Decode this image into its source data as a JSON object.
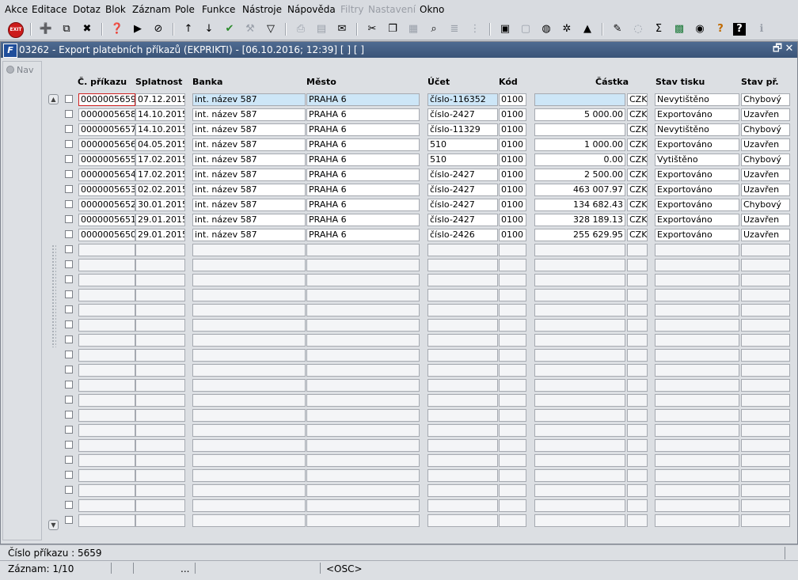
{
  "menu": [
    "Akce",
    "Editace",
    "Dotaz",
    "Blok",
    "Záznam",
    "Pole",
    "Funkce",
    "Nástroje",
    "Nápověda",
    "Filtry",
    "Nastavení",
    "Okno"
  ],
  "menu_disabled": [
    "Filtry",
    "Nastavení"
  ],
  "toolbar": {
    "exit_label": "EXIT",
    "icons": [
      "exit-icon",
      "insert-record-icon",
      "duplicate-record-icon",
      "delete-record-icon",
      "enter-query-icon",
      "execute-query-icon",
      "cancel-query-icon",
      "sort-ascending-icon",
      "sort-descending-icon",
      "commit-checkmark-icon",
      "wrench-icon",
      "filter-icon",
      "print-icon",
      "print-setup-icon",
      "send-mail-icon",
      "cut-icon",
      "copy-icon",
      "paste-icon",
      "search-icon",
      "list-icon",
      "tree-icon",
      "clipboard-icon",
      "form-icon",
      "globe-icon",
      "settings-icon",
      "bookmark-icon",
      "edit-chart-icon",
      "refresh-icon",
      "sum-icon",
      "excel-icon",
      "web-icon",
      "help-query-icon",
      "help-icon",
      "info-icon"
    ]
  },
  "window": {
    "title": "03262 - Export platebních příkazů (EKPRIKTI) - [06.10.2016; 12:39]  [ ]  [ ]",
    "nav_label": "Nav",
    "restore_label": "🗗",
    "close_label": "✕"
  },
  "table": {
    "headers": {
      "prikaz": "Č. příkazu",
      "splatnost": "Splatnost",
      "banka": "Banka",
      "mesto": "Město",
      "ucet": "Účet",
      "kod": "Kód",
      "castka": "Částka",
      "stav_tisku": "Stav tisku",
      "stav_pr": "Stav př."
    },
    "rows": [
      {
        "prikaz": "0000005659",
        "splatnost": "07.12.2015",
        "banka": "int. název 587",
        "mesto": "PRAHA 6",
        "ucet": "číslo-116352",
        "kod": "0100",
        "castka": "",
        "mena": "CZK",
        "stav_tisku": "Nevytištěno",
        "stav_pr": "Chybový"
      },
      {
        "prikaz": "0000005658",
        "splatnost": "14.10.2015",
        "banka": "int. název 587",
        "mesto": "PRAHA 6",
        "ucet": "číslo-2427",
        "kod": "0100",
        "castka": "5 000.00",
        "mena": "CZK",
        "stav_tisku": "Exportováno",
        "stav_pr": "Uzavřen"
      },
      {
        "prikaz": "0000005657",
        "splatnost": "14.10.2015",
        "banka": "int. název 587",
        "mesto": "PRAHA 6",
        "ucet": "číslo-11329",
        "kod": "0100",
        "castka": "",
        "mena": "CZK",
        "stav_tisku": "Nevytištěno",
        "stav_pr": "Chybový"
      },
      {
        "prikaz": "0000005656",
        "splatnost": "04.05.2015",
        "banka": "int. název 587",
        "mesto": "PRAHA 6",
        "ucet": "510",
        "kod": "0100",
        "castka": "1 000.00",
        "mena": "CZK",
        "stav_tisku": "Exportováno",
        "stav_pr": "Uzavřen"
      },
      {
        "prikaz": "0000005655",
        "splatnost": "17.02.2015",
        "banka": "int. název 587",
        "mesto": "PRAHA 6",
        "ucet": "510",
        "kod": "0100",
        "castka": "0.00",
        "mena": "CZK",
        "stav_tisku": "Vytištěno",
        "stav_pr": "Chybový"
      },
      {
        "prikaz": "0000005654",
        "splatnost": "17.02.2015",
        "banka": "int. název 587",
        "mesto": "PRAHA 6",
        "ucet": "číslo-2427",
        "kod": "0100",
        "castka": "2 500.00",
        "mena": "CZK",
        "stav_tisku": "Exportováno",
        "stav_pr": "Uzavřen"
      },
      {
        "prikaz": "0000005653",
        "splatnost": "02.02.2015",
        "banka": "int. název 587",
        "mesto": "PRAHA 6",
        "ucet": "číslo-2427",
        "kod": "0100",
        "castka": "463 007.97",
        "mena": "CZK",
        "stav_tisku": "Exportováno",
        "stav_pr": "Uzavřen"
      },
      {
        "prikaz": "0000005652",
        "splatnost": "30.01.2015",
        "banka": "int. název 587",
        "mesto": "PRAHA 6",
        "ucet": "číslo-2427",
        "kod": "0100",
        "castka": "134 682.43",
        "mena": "CZK",
        "stav_tisku": "Exportováno",
        "stav_pr": "Chybový"
      },
      {
        "prikaz": "0000005651",
        "splatnost": "29.01.2015",
        "banka": "int. název 587",
        "mesto": "PRAHA 6",
        "ucet": "číslo-2427",
        "kod": "0100",
        "castka": "328 189.13",
        "mena": "CZK",
        "stav_tisku": "Exportováno",
        "stav_pr": "Uzavřen"
      },
      {
        "prikaz": "0000005650",
        "splatnost": "29.01.2015",
        "banka": "int. název 587",
        "mesto": "PRAHA 6",
        "ucet": "číslo-2426",
        "kod": "0100",
        "castka": "255 629.95",
        "mena": "CZK",
        "stav_tisku": "Exportováno",
        "stav_pr": "Uzavřen"
      }
    ],
    "empty_rows": 19
  },
  "status": {
    "hint": "Číslo příkazu : 5659",
    "record": "Záznam: 1/10",
    "ellipsis": "...",
    "mode": "<OSC>"
  }
}
